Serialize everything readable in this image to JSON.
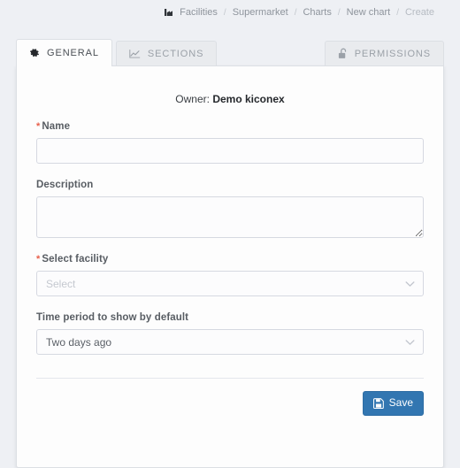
{
  "breadcrumb": {
    "icon": "factory-icon",
    "items": [
      {
        "label": "Facilities",
        "muted": false
      },
      {
        "label": "Supermarket",
        "muted": false
      },
      {
        "label": "Charts",
        "muted": false
      },
      {
        "label": "New chart",
        "muted": false
      },
      {
        "label": "Create",
        "muted": true
      }
    ],
    "separator": "/"
  },
  "tabs": [
    {
      "label": "GENERAL",
      "icon": "gear-icon",
      "active": true
    },
    {
      "label": "SECTIONS",
      "icon": "line-chart-icon",
      "active": false
    },
    {
      "label": "PERMISSIONS",
      "icon": "unlock-icon",
      "active": false
    }
  ],
  "form": {
    "owner_label": "Owner:",
    "owner_value": "Demo kiconex",
    "name": {
      "label": "Name",
      "required": true,
      "value": "",
      "placeholder": ""
    },
    "description": {
      "label": "Description",
      "required": false,
      "value": "",
      "placeholder": ""
    },
    "facility": {
      "label": "Select facility",
      "required": true,
      "value": "",
      "placeholder": "Select"
    },
    "time_period": {
      "label": "Time period to show by default",
      "required": false,
      "value": "Two days ago"
    },
    "required_marker": "*"
  },
  "footer": {
    "save_label": "Save",
    "save_icon": "floppy-save-icon"
  },
  "colors": {
    "page_background": "#eef0f4",
    "card_background": "#fdfdfd",
    "primary_button": "#3276b1",
    "required_asterisk": "#e8604c",
    "border": "#dcdfe4"
  }
}
